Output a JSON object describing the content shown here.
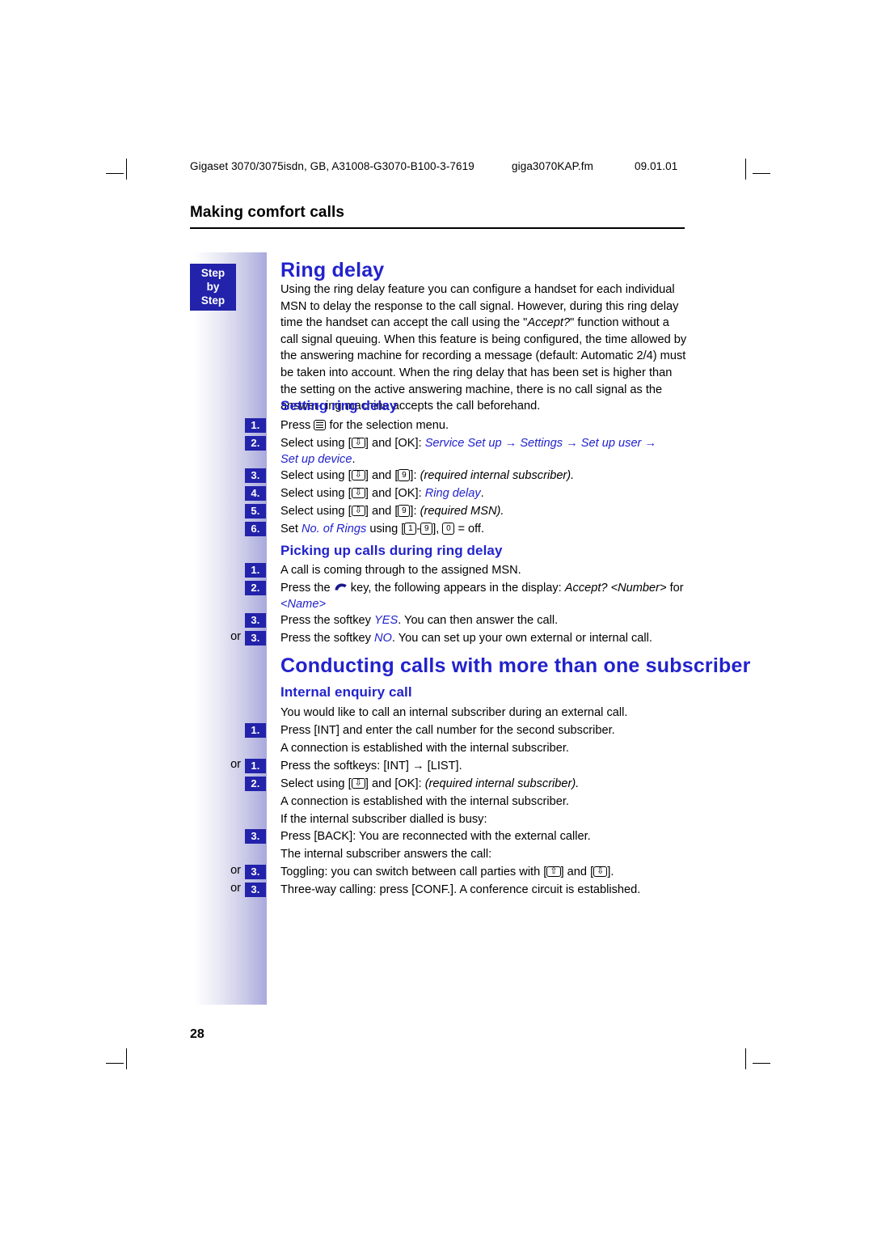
{
  "header": {
    "left": "Gigaset 3070/3075isdn, GB, A31008-G3070-B100-3-7619",
    "file": "giga3070KAP.fm",
    "date": "09.01.01"
  },
  "chapter": "Making comfort calls",
  "step_badge": {
    "line1": "Step",
    "line2": "by",
    "line3": "Step"
  },
  "sections": {
    "ring_delay": {
      "title": "Ring delay",
      "intro": "Using the ring delay feature you can configure a handset for each individual MSN to delay the response to the call signal. However, during this ring delay time the handset can accept the call using the \"Accept?\" function without a call signal queuing. When this feature is being configured, the time allowed by the answering machine for recording a message (default: Automatic 2/4) must be taken into account. When the ring delay that has been set is higher than the setting on the active answering machine, there is no call signal as the answering machine accepts the call beforehand.",
      "intro_italic": "Accept?",
      "sub1": {
        "title": "Setting ring delay",
        "steps": [
          {
            "num": "1.",
            "text": "Press  for the selection menu."
          },
          {
            "num": "2.",
            "text": "Select using [] and [OK]: Service Set up → Settings → Set up user → Set up device."
          },
          {
            "num": "3.",
            "text": "Select using [] and []: (required internal subscriber)."
          },
          {
            "num": "4.",
            "text": "Select using [] and [OK]: Ring delay."
          },
          {
            "num": "5.",
            "text": "Select using [] and []: (required MSN)."
          },
          {
            "num": "6.",
            "text": "Set No. of Rings using [1 - 9], [0] = off."
          }
        ]
      },
      "sub2": {
        "title": "Picking up calls during ring delay",
        "steps": [
          {
            "num": "1.",
            "or": "",
            "text": "A call is coming through to the assigned MSN."
          },
          {
            "num": "2.",
            "or": "",
            "text": "Press the  key, the following appears in the display: Accept? <Number> for <Name>"
          },
          {
            "num": "3.",
            "or": "",
            "text": "Press the softkey YES. You can then answer the call."
          },
          {
            "num": "3.",
            "or": "or",
            "text": "Press the softkey NO. You can set up your own external or internal call."
          }
        ]
      }
    },
    "conducting": {
      "title": "Conducting calls with more than one subscriber",
      "sub1": {
        "title": "Internal enquiry call",
        "intro": "You would like to call an internal subscriber during an external call.",
        "steps": [
          {
            "num": "1.",
            "or": "",
            "text": "Press [INT] and enter the call number for the second subscriber."
          },
          {
            "num": "",
            "or": "",
            "text": "A connection is established with the internal subscriber."
          },
          {
            "num": "1.",
            "or": "or",
            "text": "Press the softkeys: [INT] → [LIST]."
          },
          {
            "num": "2.",
            "or": "",
            "text": "Select using [] and [OK]: (required internal subscriber)."
          },
          {
            "num": "",
            "or": "",
            "text": "A connection is established with the internal subscriber."
          },
          {
            "num": "",
            "or": "",
            "text": "If the internal subscriber dialled is busy:"
          },
          {
            "num": "3.",
            "or": "",
            "text": "Press [BACK]: You are reconnected with the external caller."
          },
          {
            "num": "",
            "or": "",
            "text": "The internal subscriber answers the call:"
          },
          {
            "num": "3.",
            "or": "or",
            "text": "Toggling: you can switch between call parties with [] and []."
          },
          {
            "num": "3.",
            "or": "or",
            "text": "Three-way calling: press [CONF.]. A conference circuit is established."
          }
        ]
      }
    }
  },
  "fragments": {
    "press": "Press",
    "for_selection_menu": "for the selection menu.",
    "select_using": "Select using",
    "and": "and",
    "ok": "[OK]:",
    "service_setup": "Service Set up",
    "arrow": "→",
    "settings": "Settings",
    "setup_user": "Set up user",
    "setup_device": "Set up device",
    "required_internal_subscriber": "(required internal subscriber).",
    "ring_delay_item": "Ring delay",
    "required_msn": "(required MSN).",
    "set": "Set",
    "no_of_rings": "No. of Rings",
    "using": "using",
    "off": "= off.",
    "dash": "-",
    "comma": ",",
    "bracket_open": "[",
    "bracket_close": "],",
    "bracket_close2": "]:",
    "call_coming": "A call is coming through to the assigned MSN.",
    "press_the": "Press the",
    "key_following": "key, the following appears in the display:",
    "accept_number": "Accept? <Number>",
    "for_word": "for",
    "name_tag": "<Name>",
    "press_softkey": "Press the softkey",
    "yes": "YES",
    "yes_rest": ". You can then answer the call.",
    "no": "NO",
    "no_rest": ". You can set up your own external or internal call.",
    "key1": "1",
    "key9a": "9",
    "key9b": "9",
    "key0": "0",
    "key9c": "9"
  },
  "page_number": "28"
}
